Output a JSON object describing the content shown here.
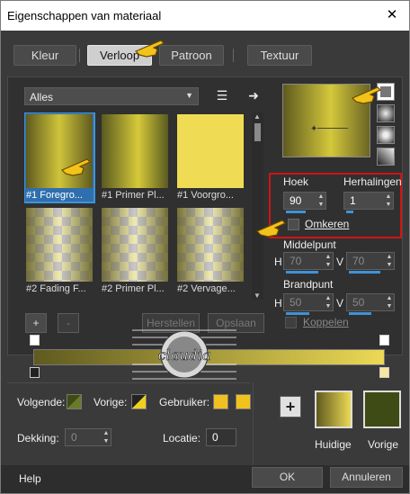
{
  "window": {
    "title": "Eigenschappen van materiaal",
    "close_glyph": "✕"
  },
  "tabs": [
    {
      "label": "Kleur"
    },
    {
      "label": "Verloop"
    },
    {
      "label": "Patroon"
    },
    {
      "label": "Textuur"
    }
  ],
  "gallery": {
    "filter_value": "Alles",
    "items": [
      {
        "label": "#1 Foregro..."
      },
      {
        "label": "#1 Primer Pl..."
      },
      {
        "label": "#1 Voorgro..."
      },
      {
        "label": "#2 Fading F..."
      },
      {
        "label": "#2 Primer Pl..."
      },
      {
        "label": "#2 Vervage..."
      }
    ]
  },
  "settings": {
    "hoek_label": "Hoek",
    "hoek_value": "90",
    "herhalingen_label": "Herhalingen",
    "herhalingen_value": "1",
    "omkeren_label": "Omkeren",
    "middelpunt_label": "Middelpunt",
    "middelpunt_h_label": "H",
    "middelpunt_h": "70",
    "middelpunt_v_label": "V",
    "middelpunt_v": "70",
    "brandpunt_label": "Brandpunt",
    "brandpunt_h_label": "H",
    "brandpunt_h": "50",
    "brandpunt_v_label": "V",
    "brandpunt_v": "50",
    "koppelen_label": "Koppelen"
  },
  "editor": {
    "add_label": "+",
    "remove_label": "-",
    "herstellen_label": "Herstellen",
    "opslaan_label": "Opslaan"
  },
  "colors": {
    "volgende_label": "Volgende:",
    "vorige_label": "Vorige:",
    "gebruiker_label": "Gebruiker:",
    "gradient_dark": "#5f5a1f",
    "gradient_light": "#ecd955",
    "gebruiker_1": "#f0c020",
    "gebruiker_2": "#f2c21c",
    "vorige_color": "#3e4b14",
    "selection_blue": "#3f93d8",
    "highlight_red": "#d01414"
  },
  "bottom": {
    "dekking_label": "Dekking:",
    "dekking_value": "0",
    "locatie_label": "Locatie:",
    "locatie_value": "0",
    "plus_label": "+",
    "huidige_label": "Huidige",
    "vorige_label": "Vorige"
  },
  "watermark": {
    "text": "claudia"
  },
  "footer": {
    "help_label": "Help",
    "ok_label": "OK",
    "cancel_label": "Annuleren"
  }
}
